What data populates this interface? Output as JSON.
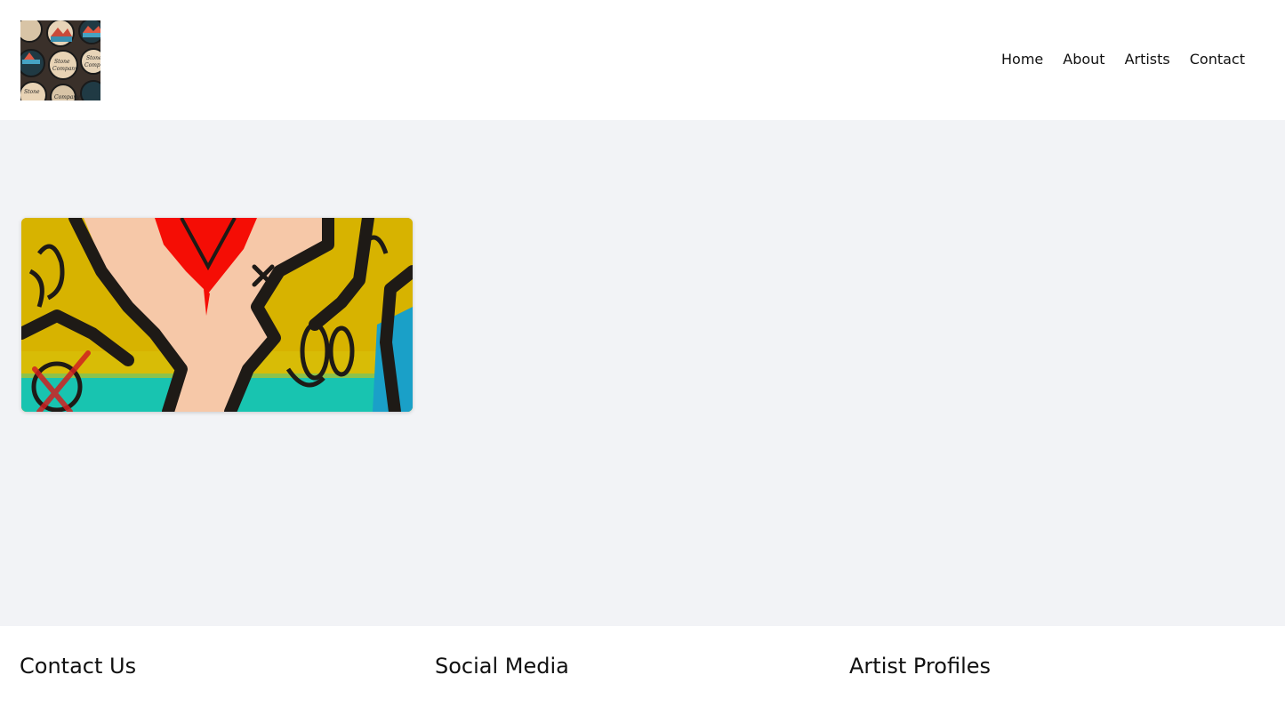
{
  "header": {
    "logo_alt": "Stone Company stickers",
    "nav": [
      {
        "label": "Home"
      },
      {
        "label": "About"
      },
      {
        "label": "Artists"
      },
      {
        "label": "Contact"
      }
    ]
  },
  "main": {
    "artwork_alt": "Colorful graffiti artwork"
  },
  "footer": {
    "contact_title": "Contact Us",
    "social_title": "Social Media",
    "profiles_title": "Artist Profiles"
  }
}
